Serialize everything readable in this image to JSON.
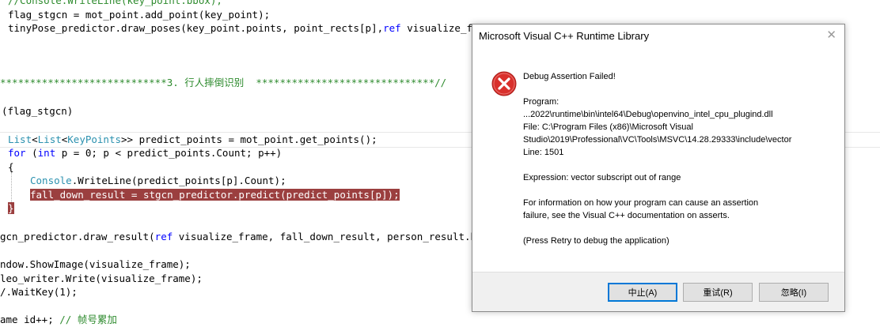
{
  "code": {
    "l0": "//Console.WriteLine(key_point.bbox);",
    "l1a": "flag_stgcn = mot_point.add_point(key_point);",
    "l2a": "tinyPose_predictor.draw_poses(key_point.points, point_rects[p],",
    "l2b": "ref",
    "l2c": " visualize_frame",
    "l3": "****************************3. 行人摔倒识别  ******************************//",
    "l4": "(flag_stgcn)",
    "l5a": "List",
    "l5b": "<",
    "l5c": "List",
    "l5d": "<",
    "l5e": "KeyPoints",
    "l5f": ">> predict_points = mot_point.get_points();",
    "l6a": "for",
    "l6b": " (",
    "l6c": "int",
    "l6d": " p = 0; p < predict_points.Count; p++)",
    "l7": "{",
    "l8a": "Console",
    "l8b": ".WriteLine(predict_points[p].Count);",
    "l9": "fall_down_result = stgcn_predictor.predict(predict_points[p]);",
    "l10": "}",
    "l11a": "gcn_predictor.draw_result(",
    "l11b": "ref",
    "l11c": " visualize_frame, fall_down_result, person_result.bboxs",
    "l12": "ndow.ShowImage(visualize_frame);",
    "l13": "leo_writer.Write(visualize_frame);",
    "l14": "/.WaitKey(1);",
    "l15a": "ame id++; ",
    "l15b": "// 帧号累加"
  },
  "dialog": {
    "title": "Microsoft Visual C++ Runtime Library",
    "close": "✕",
    "heading": "Debug Assertion Failed!",
    "program_label": "Program:",
    "program_path": "...2022\\runtime\\bin\\intel64\\Debug\\openvino_intel_cpu_plugind.dll",
    "file_line1": "File: C:\\Program Files (x86)\\Microsoft Visual",
    "file_line2": "Studio\\2019\\Professional\\VC\\Tools\\MSVC\\14.28.29333\\include\\vector",
    "line": "Line: 1501",
    "expression": "Expression: vector subscript out of range",
    "info1": "For information on how your program can cause an assertion",
    "info2": "failure, see the Visual C++ documentation on asserts.",
    "retry_note": "(Press Retry to debug the application)",
    "buttons": {
      "abort": "中止(A)",
      "retry": "重试(R)",
      "ignore": "忽略(I)"
    }
  },
  "colors": {
    "comment": "#2e8b2e",
    "keyword": "#0000ff",
    "type": "#2b91af",
    "breakpoint": "#9b3f3f",
    "error_icon": "#d9302c"
  }
}
